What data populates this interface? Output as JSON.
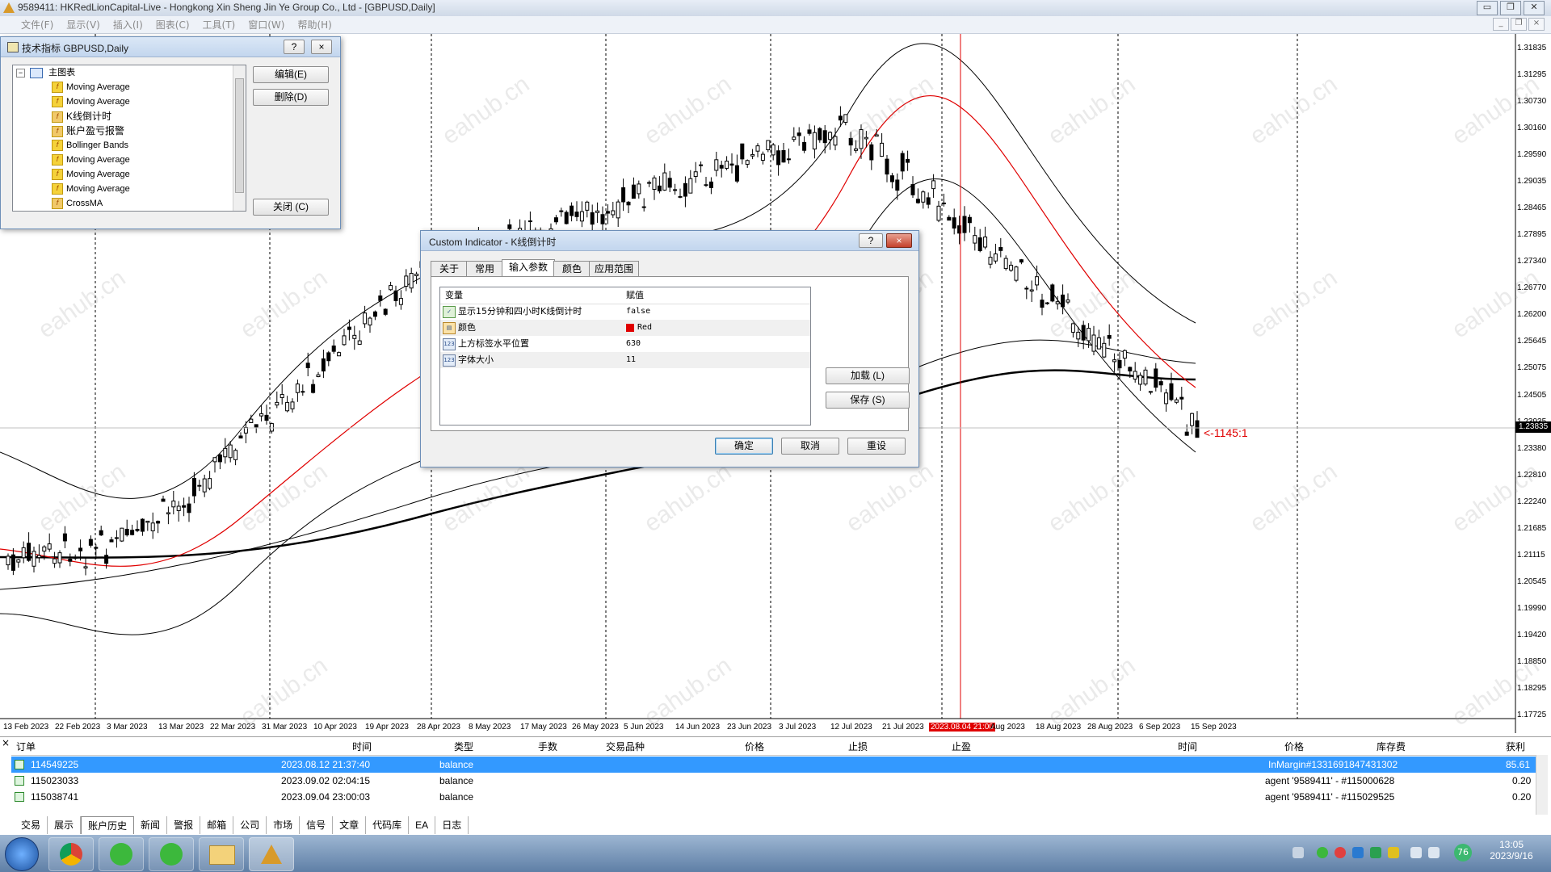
{
  "window": {
    "title": "9589411: HKRedLionCapital-Live - Hongkong Xin Sheng Jin Ye Group Co., Ltd - [GBPUSD,Daily]",
    "buttons": [
      "▭",
      "❐",
      "✕"
    ]
  },
  "menu": {
    "items": [
      "文件(F)",
      "显示(V)",
      "插入(I)",
      "图表(C)",
      "工具(T)",
      "窗口(W)",
      "帮助(H)"
    ],
    "mdi_buttons": [
      "_",
      "❐",
      "×"
    ]
  },
  "chart": {
    "symbol": "GBPUSD",
    "timeframe": "Daily",
    "price_labels": [
      "1.31835",
      "1.31295",
      "1.30730",
      "1.30160",
      "1.29590",
      "1.29035",
      "1.28465",
      "1.27895",
      "1.27340",
      "1.26770",
      "1.26200",
      "1.25645",
      "1.25075",
      "1.24505",
      "1.23935",
      "1.23380",
      "1.22810",
      "1.22240",
      "1.21685",
      "1.21115",
      "1.20545",
      "1.19990",
      "1.19420",
      "1.18850",
      "1.18295",
      "1.17725"
    ],
    "current_price": "1.23835",
    "countdown_text": "<-1145:1",
    "date_labels": [
      "13 Feb 2023",
      "22 Feb 2023",
      "3 Mar 2023",
      "13 Mar 2023",
      "22 Mar 2023",
      "31 Mar 2023",
      "10 Apr 2023",
      "19 Apr 2023",
      "28 Apr 2023",
      "8 May 2023",
      "17 May 2023",
      "26 May 2023",
      "5 Jun 2023",
      "14 Jun 2023",
      "23 Jun 2023",
      "3 Jul 2023",
      "12 Jul 2023",
      "21 Jul 2023",
      "2023.08.04 21:00",
      "Aug 2023",
      "18 Aug 2023",
      "28 Aug 2023",
      "6 Sep 2023",
      "15 Sep 2023"
    ],
    "cursor_date": "2023.08.04 21:00",
    "watermark": "eahub.cn",
    "colors": {
      "bear": "#000000",
      "bull": "#ffffff",
      "ma_red": "#e00000",
      "cursor_line": "#e00000",
      "countdown": "#e00000"
    }
  },
  "indicators_window": {
    "title": "技术指标 GBPUSD,Daily",
    "title_buttons": [
      "?",
      "×"
    ],
    "tree_root": "主图表",
    "items": [
      "Moving Average",
      "Moving Average",
      "K线倒计时",
      "账户盈亏报警",
      "Bollinger Bands",
      "Moving Average",
      "Moving Average",
      "Moving Average",
      "CrossMA"
    ],
    "buttons": {
      "edit": "编辑(E)",
      "delete": "删除(D)",
      "close": "关闭 (C)"
    }
  },
  "custom_indicator_dialog": {
    "title": "Custom Indicator - K线倒计时",
    "title_buttons": [
      "?",
      "×"
    ],
    "tabs": [
      "关于",
      "常用",
      "输入参数",
      "颜色",
      "应用范围"
    ],
    "active_tab": "输入参数",
    "table_headers": {
      "variable": "变量",
      "value": "赋值"
    },
    "params": [
      {
        "name": "显示15分钟和四小时K线倒计时",
        "value": "false",
        "icon": "bool-icon"
      },
      {
        "name": "颜色",
        "value": "Red",
        "icon": "color-icon",
        "swatch": "#e00000"
      },
      {
        "name": "上方标签水平位置",
        "value": "630",
        "icon": "int-icon"
      },
      {
        "name": "字体大小",
        "value": "11",
        "icon": "int-icon"
      }
    ],
    "side_buttons": {
      "load": "加载 (L)",
      "save": "保存 (S)"
    },
    "buttons": {
      "ok": "确定",
      "cancel": "取消",
      "reset": "重设"
    }
  },
  "terminal": {
    "headers": [
      "订单",
      "时间",
      "类型",
      "手数",
      "交易品种",
      "价格",
      "止损",
      "止盈",
      "时间",
      "价格",
      "库存费",
      "获利"
    ],
    "rows": [
      {
        "order": "114549225",
        "time": "2023.08.12 21:37:40",
        "type": "balance",
        "comment": "InMargin#1331691847431302",
        "profit": "85.61",
        "selected": true
      },
      {
        "order": "115023033",
        "time": "2023.09.02 02:04:15",
        "type": "balance",
        "comment": "agent '9589411' - #115000628",
        "profit": "0.20",
        "selected": false
      },
      {
        "order": "115038741",
        "time": "2023.09.04 23:00:03",
        "type": "balance",
        "comment": "agent '9589411' - #115029525",
        "profit": "0.20",
        "selected": false
      }
    ],
    "tabs": [
      "交易",
      "展示",
      "账户历史",
      "新闻",
      "警报",
      "邮箱",
      "公司",
      "市场",
      "信号",
      "文章",
      "代码库",
      "EA",
      "日志"
    ],
    "active_tab": "账户历史"
  },
  "taskbar": {
    "clock_time": "13:05",
    "clock_date": "2023/9/16",
    "tray_badge": "76",
    "apps": [
      "start-orb",
      "chrome",
      "update-green",
      "update-green",
      "explorer",
      "metatrader"
    ]
  }
}
